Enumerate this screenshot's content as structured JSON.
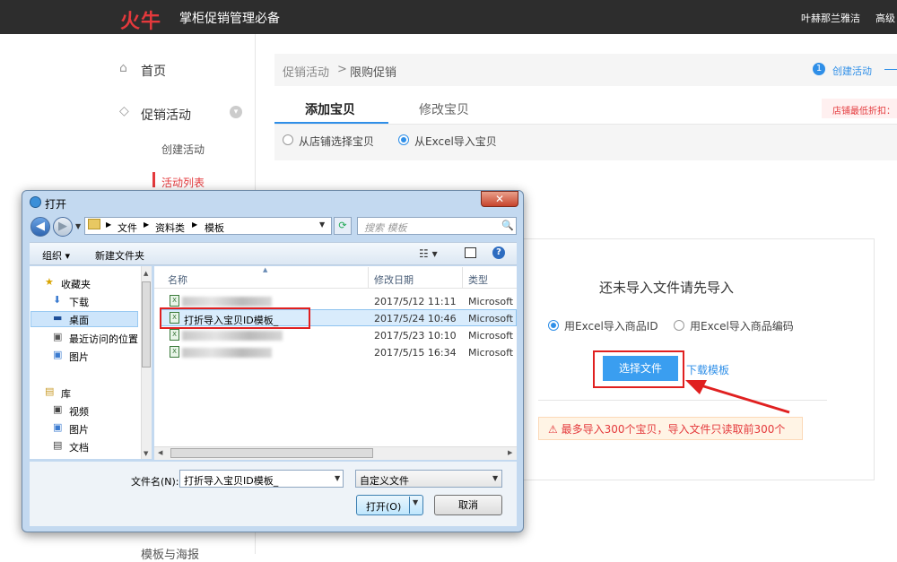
{
  "topbar": {
    "logo": "火牛",
    "app_title": "掌柜促销管理必备",
    "user": "叶赫那兰雅洁",
    "advanced": "高级"
  },
  "sidebar": {
    "home": "首页",
    "promo": "促销活动",
    "create": "创建活动",
    "list": "活动列表",
    "bottom_partial": "模板与海报"
  },
  "main": {
    "breadcrumb": {
      "parent": "促销活动",
      "sep": ">",
      "current": "限购促销"
    },
    "step": {
      "num": "1",
      "label": "创建活动"
    },
    "tabs": [
      {
        "label": "添加宝贝"
      },
      {
        "label": "修改宝贝"
      }
    ],
    "discount_note": "店铺最低折扣：",
    "source_options": [
      {
        "label": "从店铺选择宝贝",
        "selected": false
      },
      {
        "label": "从Excel导入宝贝",
        "selected": true
      }
    ],
    "import": {
      "title": "还未导入文件请先导入",
      "options": [
        {
          "label": "用Excel导入商品ID",
          "selected": true
        },
        {
          "label": "用Excel导入商品编码",
          "selected": false
        }
      ],
      "select_button": "选择文件",
      "download_link": "下载模板",
      "warning": "最多导入300个宝贝，导入文件只读取前300个"
    }
  },
  "dialog": {
    "title": "打开",
    "close": "✕",
    "path": [
      "文件",
      "资料类",
      "模板"
    ],
    "search_placeholder": "搜索 模板",
    "toolbar": {
      "organize": "组织 ▾",
      "new_folder": "新建文件夹"
    },
    "nav": {
      "favorites": "收藏夹",
      "items_fav": [
        "下载",
        "桌面",
        "最近访问的位置"
      ],
      "pictures": "图片",
      "library": "库",
      "items_lib": [
        "视频",
        "图片",
        "文档"
      ]
    },
    "columns": {
      "name": "名称",
      "date": "修改日期",
      "type": "类型"
    },
    "files": [
      {
        "name": "",
        "date": "2017/5/12 11:11",
        "type": "Microsoft"
      },
      {
        "name": "打折导入宝贝ID模板_",
        "date": "2017/5/24 10:46",
        "type": "Microsoft"
      },
      {
        "name": "",
        "date": "2017/5/23 10:10",
        "type": "Microsoft"
      },
      {
        "name": "",
        "date": "2017/5/15 16:34",
        "type": "Microsoft"
      }
    ],
    "filename_label": "文件名(N):",
    "filename_value": "打折导入宝贝ID模板_",
    "filetype": "自定义文件",
    "open_button": "打开(O)",
    "cancel_button": "取消"
  }
}
